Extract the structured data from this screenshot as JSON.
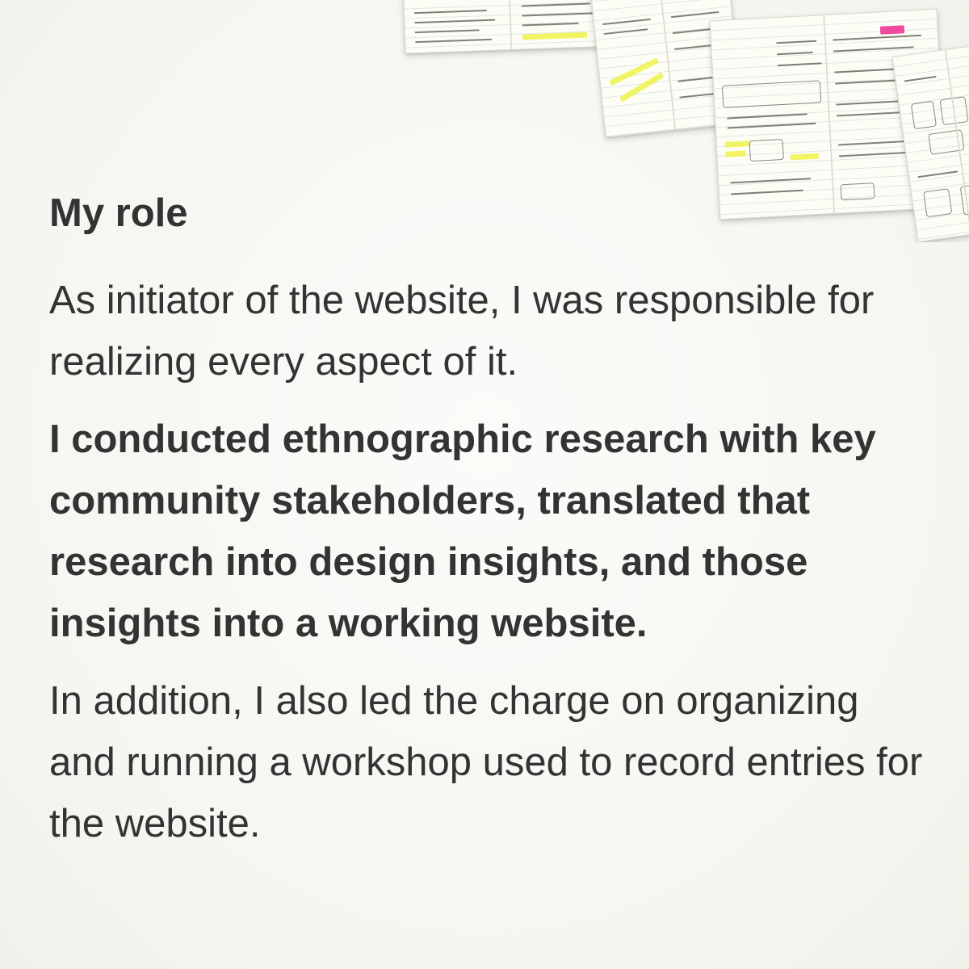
{
  "content": {
    "heading": "My role",
    "paragraph1": "As initiator of the website, I was responsible for realizing every aspect of it.",
    "paragraph2": "I conducted ethnographic research with key community stakeholders, translated that research into design insights, and those insights into a working website.",
    "paragraph3": "In addition, I also led the charge on organizing and running a workshop used to record entries for the website."
  },
  "colors": {
    "text": "#333333",
    "background": "#f6f5f1",
    "highlighter": "#eef24a",
    "tab": "#f24aa0"
  }
}
